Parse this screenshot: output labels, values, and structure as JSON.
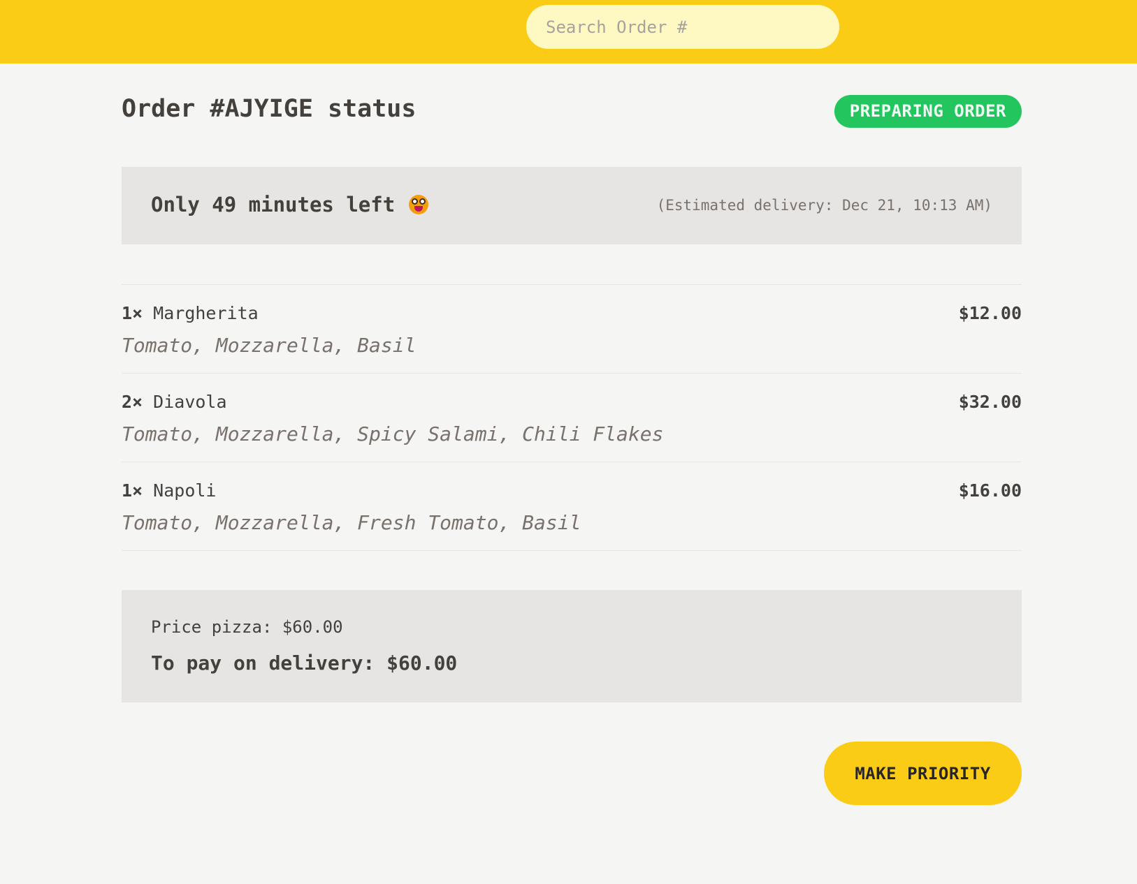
{
  "header": {
    "search_placeholder": "Search Order #"
  },
  "order": {
    "title": "Order #AJYIGE status",
    "status_badge": "PREPARING ORDER",
    "status_color": "#22c55e",
    "eta_text": "Only 49 minutes left",
    "eta_icon": "grinning-face-icon",
    "estimated_delivery": "(Estimated delivery: Dec 21, 10:13 AM)"
  },
  "items": [
    {
      "qty": "1×",
      "name": "Margherita",
      "price": "$12.00",
      "ingredients": "Tomato, Mozzarella, Basil"
    },
    {
      "qty": "2×",
      "name": "Diavola",
      "price": "$32.00",
      "ingredients": "Tomato, Mozzarella, Spicy Salami, Chili Flakes"
    },
    {
      "qty": "1×",
      "name": "Napoli",
      "price": "$16.00",
      "ingredients": "Tomato, Mozzarella, Fresh Tomato, Basil"
    }
  ],
  "totals": {
    "price_pizza": "Price pizza: $60.00",
    "to_pay": "To pay on delivery: $60.00"
  },
  "actions": {
    "make_priority": "MAKE PRIORITY"
  },
  "colors": {
    "accent": "#facc15",
    "background": "#f5f5f3",
    "panel": "#e7e5e3"
  }
}
